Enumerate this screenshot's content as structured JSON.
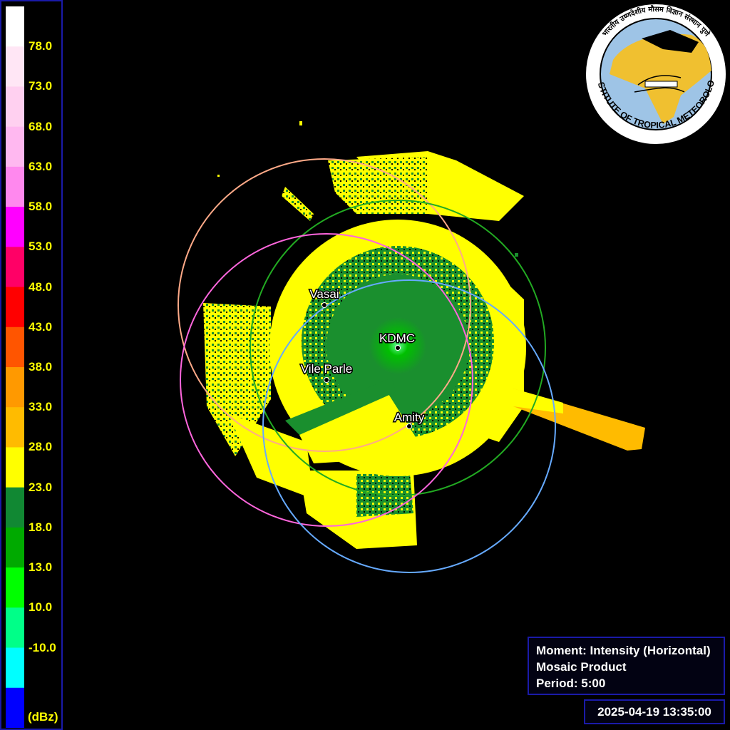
{
  "legend": {
    "unit": "(dBz)",
    "ticks": [
      "78.0",
      "73.0",
      "68.0",
      "63.0",
      "58.0",
      "53.0",
      "48.0",
      "43.0",
      "38.0",
      "33.0",
      "28.0",
      "23.0",
      "18.0",
      "13.0",
      "10.0",
      "-10.0"
    ],
    "colors": [
      "#ffffff",
      "#ffe6f5",
      "#ffd0f0",
      "#ffb8f0",
      "#ff88ee",
      "#ff00ff",
      "#ff0066",
      "#ff0000",
      "#ff5500",
      "#ff9900",
      "#ffbb00",
      "#ffff00",
      "#118833",
      "#00aa00",
      "#00ff00",
      "#00ff88",
      "#00ffff",
      "#0000ff"
    ]
  },
  "radar": {
    "colors": {
      "yellow": "#ffff00",
      "green": "#1a8f2e",
      "green_light": "#00c000",
      "green_bright": "#00ff66",
      "orange": "#ffbb00"
    },
    "sites": [
      {
        "name": "Vasai",
        "ring_color": "#ffaa88"
      },
      {
        "name": "KDMC",
        "ring_color": "#22aa22"
      },
      {
        "name": "Vile Parle",
        "ring_color": "#ff66dd"
      },
      {
        "name": "Amity",
        "ring_color": "#66aaff"
      }
    ]
  },
  "logo": {
    "text": "INDIAN INSTITUTE OF TROPICAL METEOROLOGY PUNE",
    "hindi_text": "भारतीय उष्णदेशीय मौसम विज्ञान संस्थान पुणे",
    "sea_color": "#9ec4e6",
    "land_color": "#f0c030"
  },
  "info": {
    "moment": "Moment: Intensity (Horizontal)",
    "product": "Mosaic Product",
    "period": "Period: 5:00",
    "timestamp": "2025-04-19 13:35:00"
  }
}
